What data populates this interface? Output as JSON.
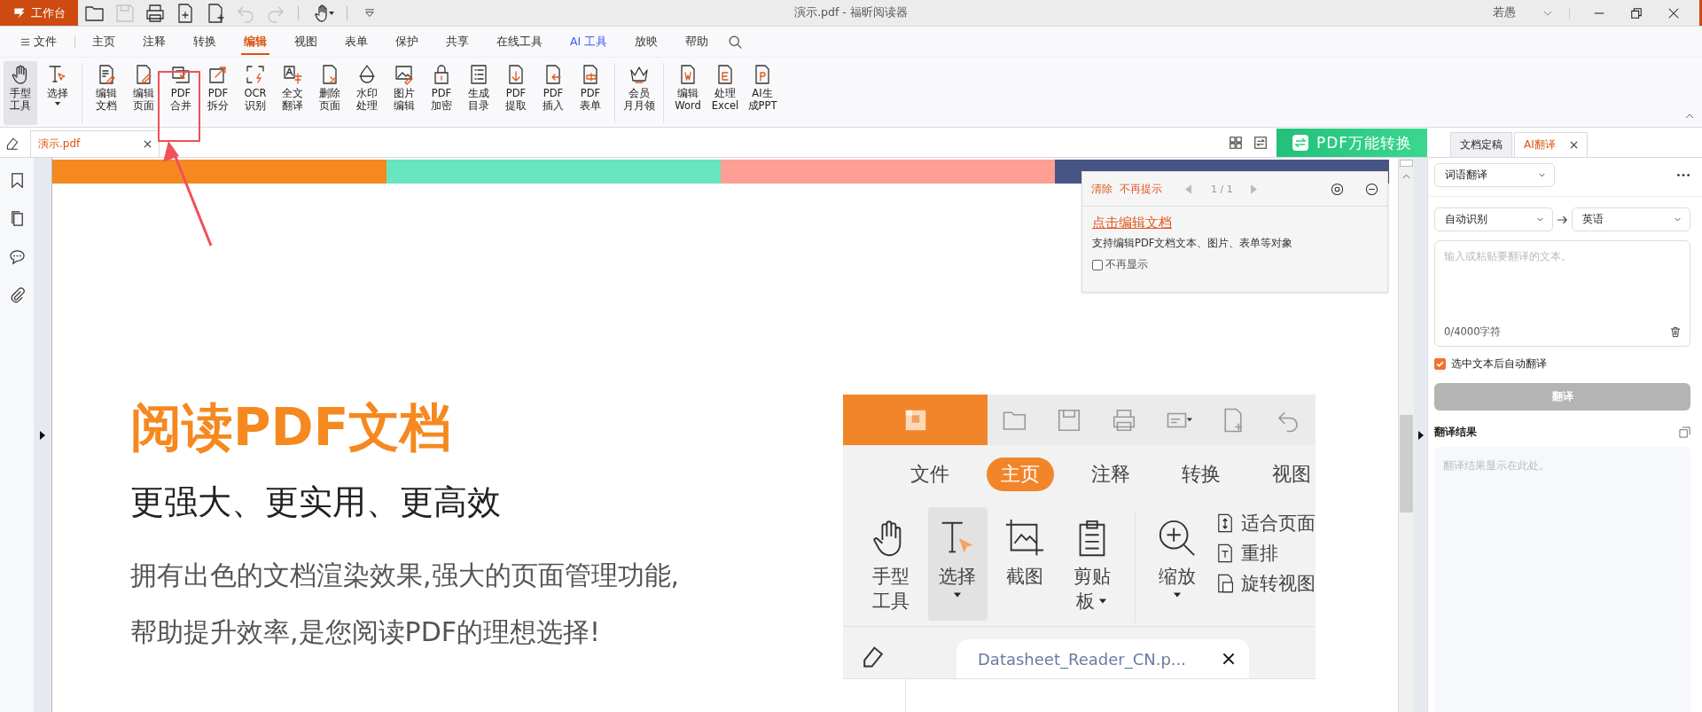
{
  "title_bar": {
    "app_button": "工作台",
    "title": "演示.pdf - 福昕阅读器",
    "user": "若愚",
    "quick_access": [
      {
        "disabled": false
      },
      {
        "disabled": true
      },
      {
        "disabled": false
      },
      {
        "disabled": false
      },
      {
        "disabled": false
      },
      {
        "disabled": true
      },
      {
        "disabled": true
      },
      {
        "disabled": false
      }
    ]
  },
  "menu_tabs": [
    {
      "label": "文件",
      "kind": "file",
      "selected": false
    },
    {
      "label": "主页",
      "kind": "plain",
      "selected": false
    },
    {
      "label": "注释",
      "kind": "plain",
      "selected": false
    },
    {
      "label": "转换",
      "kind": "plain",
      "selected": false
    },
    {
      "label": "编辑",
      "kind": "plain",
      "selected": true
    },
    {
      "label": "视图",
      "kind": "plain",
      "selected": false
    },
    {
      "label": "表单",
      "kind": "plain",
      "selected": false
    },
    {
      "label": "保护",
      "kind": "plain",
      "selected": false
    },
    {
      "label": "共享",
      "kind": "plain",
      "selected": false
    },
    {
      "label": "在线工具",
      "kind": "plain",
      "selected": false
    },
    {
      "label": "AI 工具",
      "kind": "ai",
      "selected": false
    },
    {
      "label": "放映",
      "kind": "plain",
      "selected": false
    },
    {
      "label": "帮助",
      "kind": "plain",
      "selected": false
    }
  ],
  "ribbon": {
    "groups": [
      {
        "buttons": [
          {
            "lines": [
              "手型",
              "工具"
            ],
            "selected": true,
            "dropdown": false,
            "highlighted": false
          },
          {
            "lines": [
              "选择"
            ],
            "selected": false,
            "dropdown": true,
            "highlighted": false
          }
        ]
      },
      {
        "buttons": [
          {
            "lines": [
              "编辑",
              "文档"
            ],
            "selected": false,
            "dropdown": false,
            "highlighted": false
          },
          {
            "lines": [
              "编辑",
              "页面"
            ],
            "selected": false,
            "dropdown": false,
            "highlighted": false
          },
          {
            "lines": [
              "PDF",
              "合并"
            ],
            "selected": false,
            "dropdown": false,
            "highlighted": true
          },
          {
            "lines": [
              "PDF",
              "拆分"
            ],
            "selected": false,
            "dropdown": false,
            "highlighted": false
          },
          {
            "lines": [
              "OCR",
              "识别"
            ],
            "selected": false,
            "dropdown": false,
            "highlighted": false
          },
          {
            "lines": [
              "全文",
              "翻译"
            ],
            "selected": false,
            "dropdown": false,
            "highlighted": false
          },
          {
            "lines": [
              "删除",
              "页面"
            ],
            "selected": false,
            "dropdown": false,
            "highlighted": false
          },
          {
            "lines": [
              "水印",
              "处理"
            ],
            "selected": false,
            "dropdown": false,
            "highlighted": false
          },
          {
            "lines": [
              "图片",
              "编辑"
            ],
            "selected": false,
            "dropdown": false,
            "highlighted": false
          },
          {
            "lines": [
              "PDF",
              "加密"
            ],
            "selected": false,
            "dropdown": false,
            "highlighted": false
          },
          {
            "lines": [
              "生成",
              "目录"
            ],
            "selected": false,
            "dropdown": false,
            "highlighted": false
          },
          {
            "lines": [
              "PDF",
              "提取"
            ],
            "selected": false,
            "dropdown": false,
            "highlighted": false
          },
          {
            "lines": [
              "PDF",
              "插入"
            ],
            "selected": false,
            "dropdown": false,
            "highlighted": false
          },
          {
            "lines": [
              "PDF",
              "表单"
            ],
            "selected": false,
            "dropdown": false,
            "highlighted": false
          }
        ]
      },
      {
        "buttons": [
          {
            "lines": [
              "会员",
              "月月领"
            ],
            "selected": false,
            "dropdown": false,
            "highlighted": false
          }
        ]
      },
      {
        "buttons": [
          {
            "lines": [
              "编辑",
              "Word"
            ],
            "selected": false,
            "dropdown": false,
            "highlighted": false
          },
          {
            "lines": [
              "处理",
              "Excel"
            ],
            "selected": false,
            "dropdown": false,
            "highlighted": false
          },
          {
            "lines": [
              "AI生",
              "成PPT"
            ],
            "selected": false,
            "dropdown": false,
            "highlighted": false
          }
        ]
      }
    ]
  },
  "doc_tabs": [
    {
      "label": "演示.pdf",
      "selected": true
    }
  ],
  "convert_banner": "PDF万能转换",
  "panel_tabs": [
    {
      "label": "文档定稿",
      "selected": false,
      "closable": false
    },
    {
      "label": "AI翻译",
      "selected": true,
      "closable": true
    }
  ],
  "document": {
    "color_bars": [
      {
        "color": "#f5891f"
      },
      {
        "color": "#66e5bf"
      },
      {
        "color": "#fd9f94"
      },
      {
        "color": "#475585"
      }
    ],
    "heading": "阅读PDF文档",
    "subheading": "更强大、更实用、更高效",
    "paragraph_lines": [
      "拥有出色的文档渲染效果,强大的页面管理功能,",
      "帮助提升效率,是您阅读PDF的理想选择!"
    ],
    "embedded_app": {
      "tabs": [
        {
          "label": "文件",
          "selected": false
        },
        {
          "label": "主页",
          "selected": true
        },
        {
          "label": "注释",
          "selected": false
        },
        {
          "label": "转换",
          "selected": false
        },
        {
          "label": "视图",
          "selected": false
        }
      ],
      "tools": [
        {
          "lines": [
            "手型",
            "工具"
          ],
          "selected": false,
          "dropdown": false
        },
        {
          "lines": [
            "选择"
          ],
          "selected": true,
          "dropdown": true
        },
        {
          "lines": [
            "截图"
          ],
          "selected": false,
          "dropdown": false
        },
        {
          "lines": [
            "剪贴",
            "板"
          ],
          "selected": false,
          "dropdown": true
        },
        {
          "lines": [
            "缩放"
          ],
          "selected": false,
          "dropdown": true
        }
      ],
      "view_items": [
        "适合页面",
        "重排",
        "旋转视图"
      ],
      "file_tab": "Datasheet_Reader_CN.p..."
    }
  },
  "tip_popup": {
    "actions": [
      "清除",
      "不再提示"
    ],
    "pager": "1 / 1",
    "link": "点击编辑文档",
    "description": "支持编辑PDF文档文本、图片、表单等对象",
    "checkbox": {
      "label": "不再显示",
      "checked": false
    }
  },
  "translate_panel": {
    "mode": "词语翻译",
    "source_language": "自动识别",
    "target_language": "英语",
    "placeholder": "输入或粘贴要翻译的文本。",
    "counter": "0/4000字符",
    "auto_translate": {
      "label": "选中文本后自动翻译",
      "checked": true
    },
    "translate_button": {
      "label": "翻译",
      "disabled": true
    },
    "result_title": "翻译结果",
    "result_placeholder": "翻译结果显示在此处。"
  }
}
